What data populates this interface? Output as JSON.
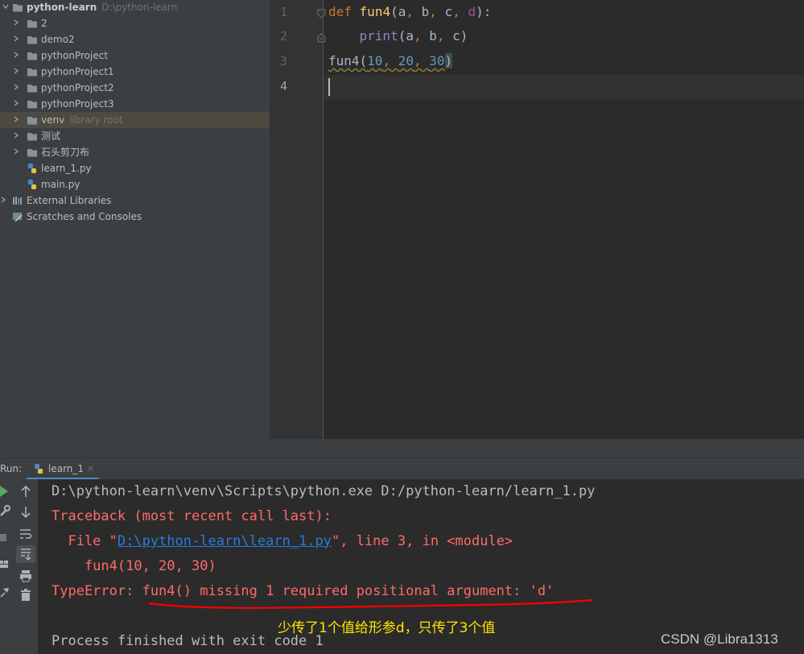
{
  "project": {
    "root_name": "python-learn",
    "root_path": "D:\\python-learn",
    "items": [
      {
        "label": "2",
        "type": "folder"
      },
      {
        "label": "demo2",
        "type": "folder"
      },
      {
        "label": "pythonProject",
        "type": "folder"
      },
      {
        "label": "pythonProject1",
        "type": "folder"
      },
      {
        "label": "pythonProject2",
        "type": "folder"
      },
      {
        "label": "pythonProject3",
        "type": "folder"
      },
      {
        "label": "venv",
        "hint": "library root",
        "type": "folder",
        "selected": true
      },
      {
        "label": "测试",
        "type": "folder"
      },
      {
        "label": "石头剪刀布",
        "type": "folder"
      },
      {
        "label": "learn_1.py",
        "type": "python-file"
      },
      {
        "label": "main.py",
        "type": "python-file"
      }
    ],
    "external_libraries": "External Libraries",
    "scratches": "Scratches and Consoles"
  },
  "editor": {
    "line_numbers": [
      "1",
      "2",
      "3",
      "4"
    ],
    "code": {
      "l1_def": "def",
      "l1_name": "fun4",
      "l1_open": "(",
      "l1_a": "a",
      "l1_b": "b",
      "l1_c": "c",
      "l1_d": "d",
      "l1_close": "):",
      "l2_indent": "    ",
      "l2_print": "print",
      "l2_args_open": "(a",
      "l2_b": " b",
      "l2_c": " c)",
      "l3_name": "fun4(",
      "l3_n1": "10",
      "l3_n2": "20",
      "l3_n3": "30",
      "l3_close": ")",
      "comma": ","
    }
  },
  "run": {
    "label": "Run:",
    "tab_label": "learn_1",
    "tab_close": "×",
    "lines": {
      "cmd": "D:\\python-learn\\venv\\Scripts\\python.exe D:/python-learn/learn_1.py",
      "traceback": "Traceback (most recent call last):",
      "file_prefix": "  File \"",
      "file_link": "D:\\python-learn\\learn_1.py",
      "file_suffix": "\", line 3, in <module>",
      "call": "    fun4(10, 20, 30)",
      "error": "TypeError: fun4() missing 1 required positional argument: 'd'",
      "finished": "Process finished with exit code 1"
    }
  },
  "annotation": {
    "note": "少传了1个值给形参d，只传了3个值"
  },
  "watermark": "CSDN @Libra1313",
  "colors": {
    "keyword": "#cc7832",
    "function": "#ffc66d",
    "number": "#6897bb",
    "error": "#ff6b68",
    "link": "#287bde",
    "annotation": "#ffe600",
    "annotation_line": "#ff0000"
  }
}
